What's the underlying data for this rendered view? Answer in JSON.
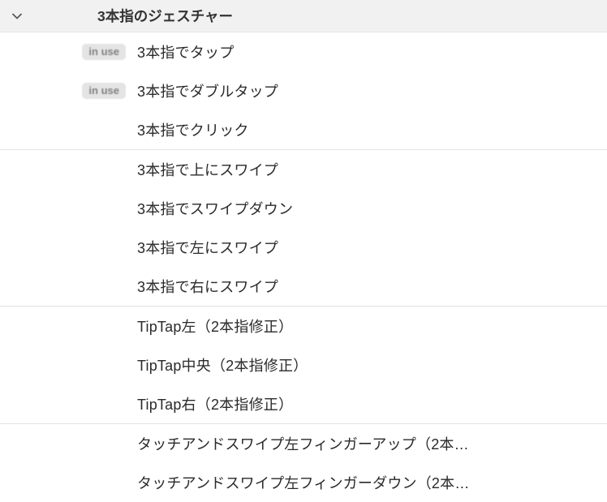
{
  "section": {
    "title": "3本指のジェスチャー"
  },
  "badge_label": "in use",
  "groups": [
    {
      "items": [
        {
          "label": "3本指でタップ",
          "in_use": true
        },
        {
          "label": "3本指でダブルタップ",
          "in_use": true
        },
        {
          "label": "3本指でクリック",
          "in_use": false
        }
      ]
    },
    {
      "items": [
        {
          "label": "3本指で上にスワイプ",
          "in_use": false
        },
        {
          "label": "3本指でスワイプダウン",
          "in_use": false
        },
        {
          "label": "3本指で左にスワイプ",
          "in_use": false
        },
        {
          "label": "3本指で右にスワイプ",
          "in_use": false
        }
      ]
    },
    {
      "items": [
        {
          "label": "TipTap左（2本指修正）",
          "in_use": false
        },
        {
          "label": "TipTap中央（2本指修正）",
          "in_use": false
        },
        {
          "label": "TipTap右（2本指修正）",
          "in_use": false
        }
      ]
    },
    {
      "items": [
        {
          "label": "タッチアンドスワイプ左フィンガーアップ（2本…",
          "in_use": false
        },
        {
          "label": "タッチアンドスワイプ左フィンガーダウン（2本…",
          "in_use": false
        }
      ]
    }
  ]
}
